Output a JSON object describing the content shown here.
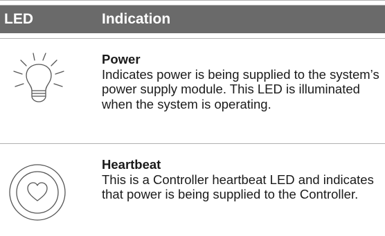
{
  "table": {
    "headers": {
      "led": "LED",
      "indication": "Indication"
    },
    "rows": [
      {
        "icon": "lightbulb-icon",
        "title": "Power",
        "description": "Indicates power is being supplied to the system’s power supply module. This LED is illuminated when the system is operating."
      },
      {
        "icon": "heart-icon",
        "title": "Heartbeat",
        "description": "This is a Controller heartbeat LED and indicates that power is being supplied to the Controller."
      }
    ]
  },
  "colors": {
    "header_bg": "#6a6a6a",
    "header_text": "#ffffff",
    "rule": "#b0b0b0",
    "icon_stroke": "#555555"
  }
}
